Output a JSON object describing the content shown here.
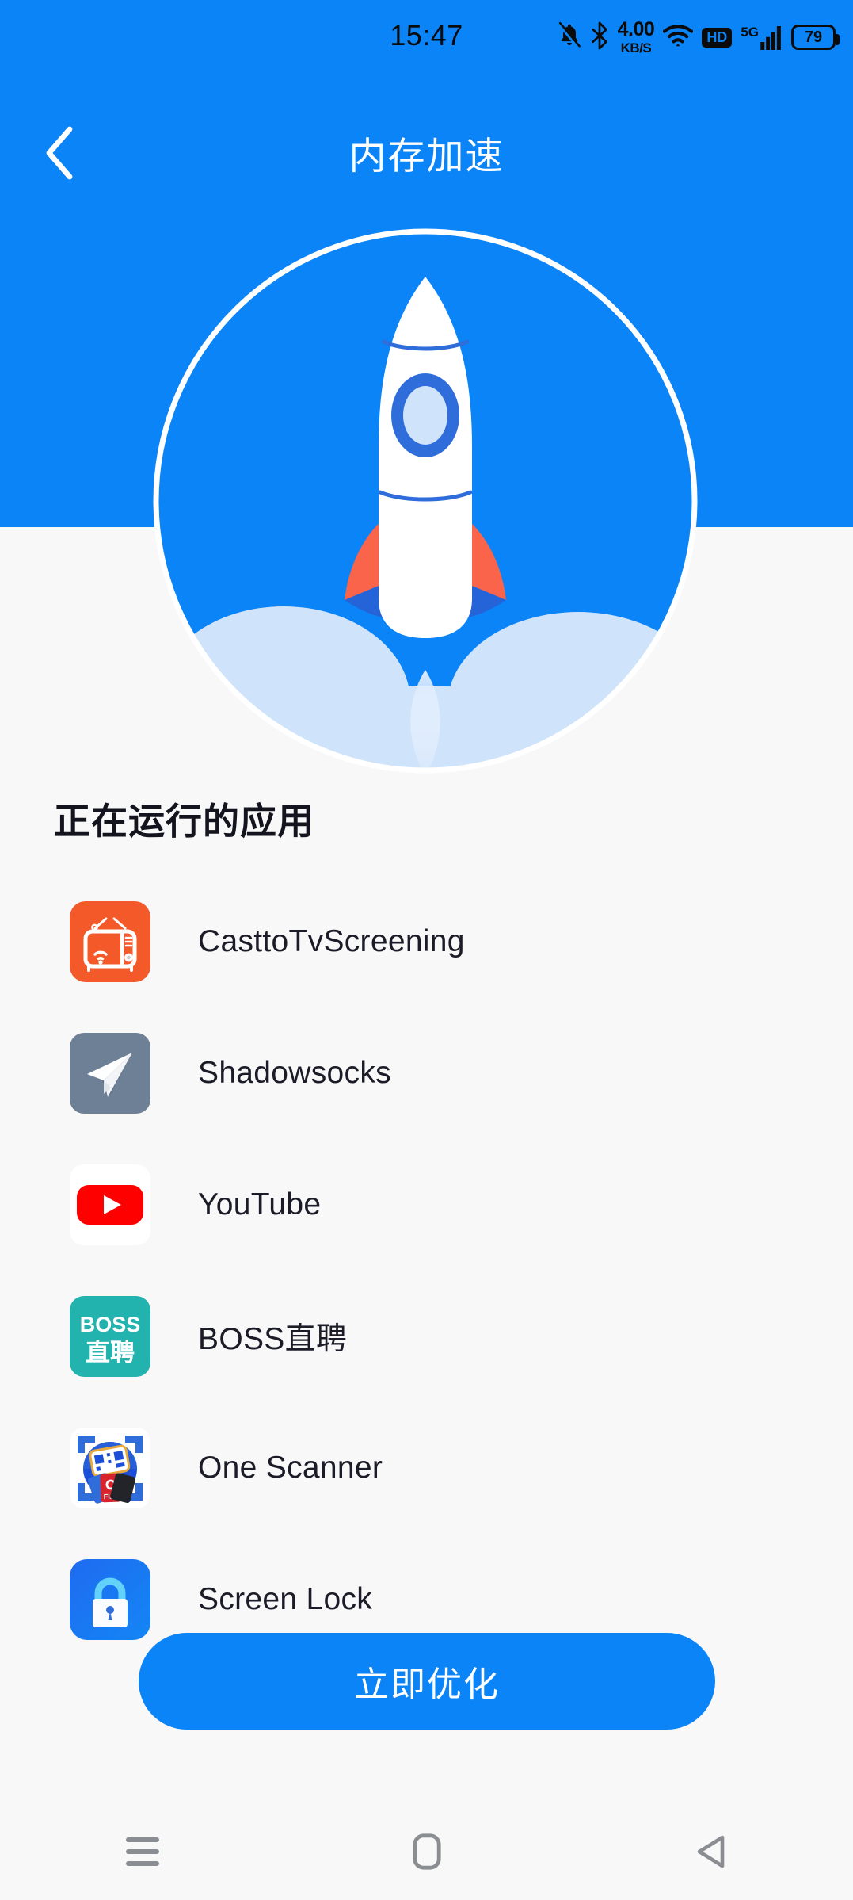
{
  "status_bar": {
    "time": "15:47",
    "network_speed_value": "4.00",
    "network_speed_unit": "KB/S",
    "hd_label": "HD",
    "network_type": "5G",
    "battery_percent": "79",
    "icons": [
      "mute-icon",
      "bluetooth-icon",
      "wifi-icon",
      "hd-icon",
      "signal-icon",
      "battery-icon"
    ]
  },
  "appbar": {
    "back_icon": "chevron-left-icon",
    "title": "内存加速"
  },
  "hero": {
    "illustration": "rocket-launch-illustration",
    "circle_stroke_color": "#ffffff",
    "circle_fill_color": "#0b84f8",
    "rocket_body_color": "#ffffff",
    "rocket_fin_color": "#f9644a",
    "cloud_color": "#cfe3fb"
  },
  "main": {
    "section_title": "正在运行的应用",
    "apps": [
      {
        "name": "CasttoTvScreening",
        "icon": "casttotvscreening-app-icon",
        "color": "#f4592a"
      },
      {
        "name": "Shadowsocks",
        "icon": "shadowsocks-app-icon",
        "color": "#6e8096"
      },
      {
        "name": "YouTube",
        "icon": "youtube-app-icon",
        "color": "#ff0000"
      },
      {
        "name": "BOSS直聘",
        "icon": "boss-zhipin-app-icon",
        "color": "#23b3ae"
      },
      {
        "name": "One Scanner",
        "icon": "one-scanner-app-icon",
        "color": "#2f6ddb"
      },
      {
        "name": "Screen Lock",
        "icon": "screen-lock-app-icon",
        "color": "#1565e8"
      }
    ]
  },
  "cta": {
    "label": "立即优化",
    "color": "#0b84f8"
  },
  "navbar": {
    "recents_label": "recents-icon",
    "home_label": "home-icon",
    "back_label": "back-icon"
  },
  "boss_icon_text": {
    "line1": "BOSS",
    "line2": "直聘"
  }
}
